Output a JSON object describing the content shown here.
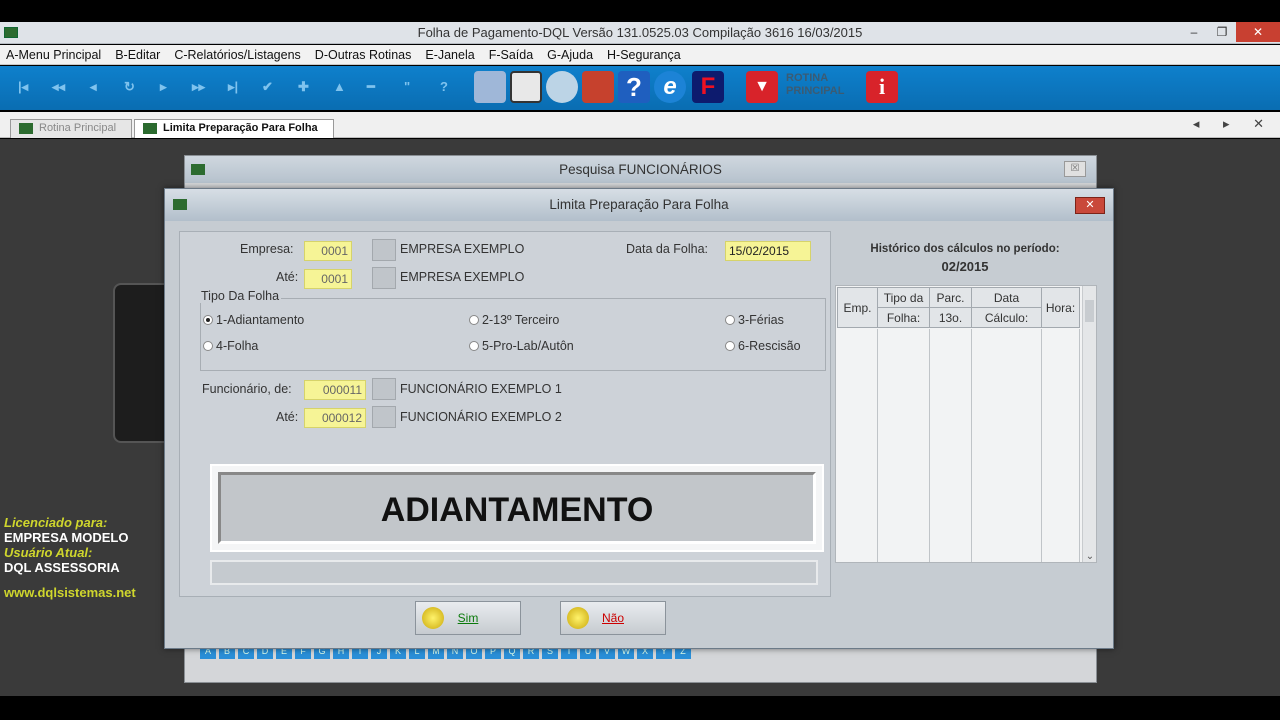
{
  "window": {
    "title": "Folha de Pagamento-DQL  Versão 131.0525.03 Compilação 3616  16/03/2015",
    "minimize": "–",
    "restore": "❐",
    "close": "✕"
  },
  "menu": [
    "A-Menu Principal",
    "B-Editar",
    "C-Relatórios/Listagens",
    "D-Outras Rotinas",
    "E-Janela",
    "F-Saída",
    "G-Ajuda",
    "H-Segurança"
  ],
  "toolbar": {
    "nav": [
      "|◂",
      "◂◂",
      "◂",
      "↻",
      "▸",
      "▸▸",
      "▸|",
      "✔",
      "✚",
      "▲",
      "━",
      "\"",
      "?"
    ],
    "rotina_line1": "ROTINA",
    "rotina_line2": "PRINCIPAL",
    "colors": {
      "toolbar": "#0a6db2",
      "red": "#d8232a"
    }
  },
  "tabs": [
    {
      "label": "Rotina Principal",
      "active": false
    },
    {
      "label": "Limita Preparação Para Folha",
      "active": true
    }
  ],
  "tab_arrows": "◂ ▸ ✕",
  "license": {
    "label1": "Licenciado para:",
    "value1": "EMPRESA MODELO",
    "label2": "Usuário Atual:",
    "value2": "DQL ASSESSORIA",
    "url": "www.dqlsistemas.net"
  },
  "bg_window": {
    "title": "Pesquisa FUNCIONÁRIOS",
    "close": "☒"
  },
  "alphabet": [
    "A",
    "B",
    "C",
    "D",
    "E",
    "F",
    "G",
    "H",
    "I",
    "J",
    "K",
    "L",
    "M",
    "N",
    "O",
    "P",
    "Q",
    "R",
    "S",
    "T",
    "U",
    "V",
    "W",
    "X",
    "Y",
    "Z"
  ],
  "dialog": {
    "title": "Limita Preparação Para Folha",
    "close": "✕",
    "empresa_label": "Empresa:",
    "empresa_code": "0001",
    "empresa_name": "EMPRESA EXEMPLO",
    "ate_label": "Até:",
    "ate_code": "0001",
    "ate_name": "EMPRESA EXEMPLO",
    "data_folha_label": "Data da Folha:",
    "data_folha": "15/02/2015",
    "tipo_label": "Tipo Da Folha",
    "radios": [
      {
        "label": "1-Adiantamento",
        "selected": true
      },
      {
        "label": "2-13º Terceiro",
        "selected": false
      },
      {
        "label": "3-Férias",
        "selected": false
      },
      {
        "label": "4-Folha",
        "selected": false
      },
      {
        "label": "5-Pro-Lab/Autôn",
        "selected": false
      },
      {
        "label": "6-Rescisão",
        "selected": false
      }
    ],
    "func_label": "Funcionário, de:",
    "func_code": "000011",
    "func_name": "FUNCIONÁRIO EXEMPLO 1",
    "func_ate_label": "Até:",
    "func_ate_code": "000012",
    "func_ate_name": "FUNCIONÁRIO EXEMPLO 2",
    "banner": "ADIANTAMENTO",
    "sim": "Sim",
    "nao": "Não",
    "hist_title": "Histórico dos cálculos no período:",
    "hist_period": "02/2015",
    "grid_headers_row1": [
      "Emp.",
      "Tipo da",
      "Parc.",
      "Data",
      "Hora:"
    ],
    "grid_headers_row2": [
      "Folha:",
      "13o.",
      "Cálculo:"
    ],
    "scroll_down": "⌄"
  }
}
